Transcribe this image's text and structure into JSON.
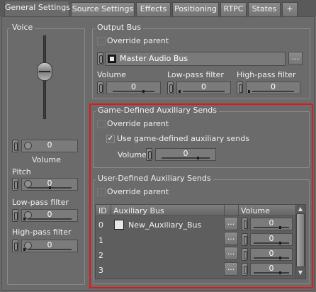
{
  "tabs": [
    {
      "label": "General Settings",
      "active": true
    },
    {
      "label": "Source Settings",
      "active": false
    },
    {
      "label": "Effects",
      "active": false
    },
    {
      "label": "Positioning",
      "active": false
    },
    {
      "label": "RTPC",
      "active": false
    },
    {
      "label": "States",
      "active": false
    },
    {
      "label": "+",
      "active": false
    }
  ],
  "voice": {
    "title": "Voice",
    "volume_label": "Volume",
    "volume_value": "0",
    "pitch_label": "Pitch",
    "pitch_value": "0",
    "lowpass_label": "Low-pass filter",
    "lowpass_value": "0",
    "highpass_label": "High-pass filter",
    "highpass_value": "0"
  },
  "output_bus": {
    "title": "Output Bus",
    "override_parent": "Override parent",
    "bus_name": "Master Audio Bus",
    "browse_label": "...",
    "volume_label": "Volume",
    "volume_value": "0",
    "lowpass_label": "Low-pass filter",
    "lowpass_value": "0",
    "highpass_label": "High-pass filter",
    "highpass_value": "0"
  },
  "game_defined": {
    "title": "Game-Defined Auxiliary Sends",
    "override_parent": "Override parent",
    "use_label": "Use game-defined auxiliary sends",
    "use_checked": true,
    "volume_label": "Volume",
    "volume_value": "0"
  },
  "user_defined": {
    "title": "User-Defined Auxiliary Sends",
    "override_parent": "Override parent",
    "columns": {
      "id": "ID",
      "bus": "Auxiliary Bus",
      "volume": "Volume"
    },
    "rows": [
      {
        "id": "0",
        "bus": "New_Auxiliary_Bus",
        "volume": "0",
        "browse": "..."
      },
      {
        "id": "1",
        "bus": "",
        "volume": "0",
        "browse": "..."
      },
      {
        "id": "2",
        "bus": "",
        "volume": "0",
        "browse": "..."
      },
      {
        "id": "3",
        "bus": "",
        "volume": "0",
        "browse": "..."
      }
    ]
  },
  "icons": {
    "scroll_up": "▲",
    "scroll_down": "▼",
    "check": "✓"
  },
  "colors": {
    "highlight_frame": "#e01818",
    "panel_bg": "#6b6b6b"
  }
}
